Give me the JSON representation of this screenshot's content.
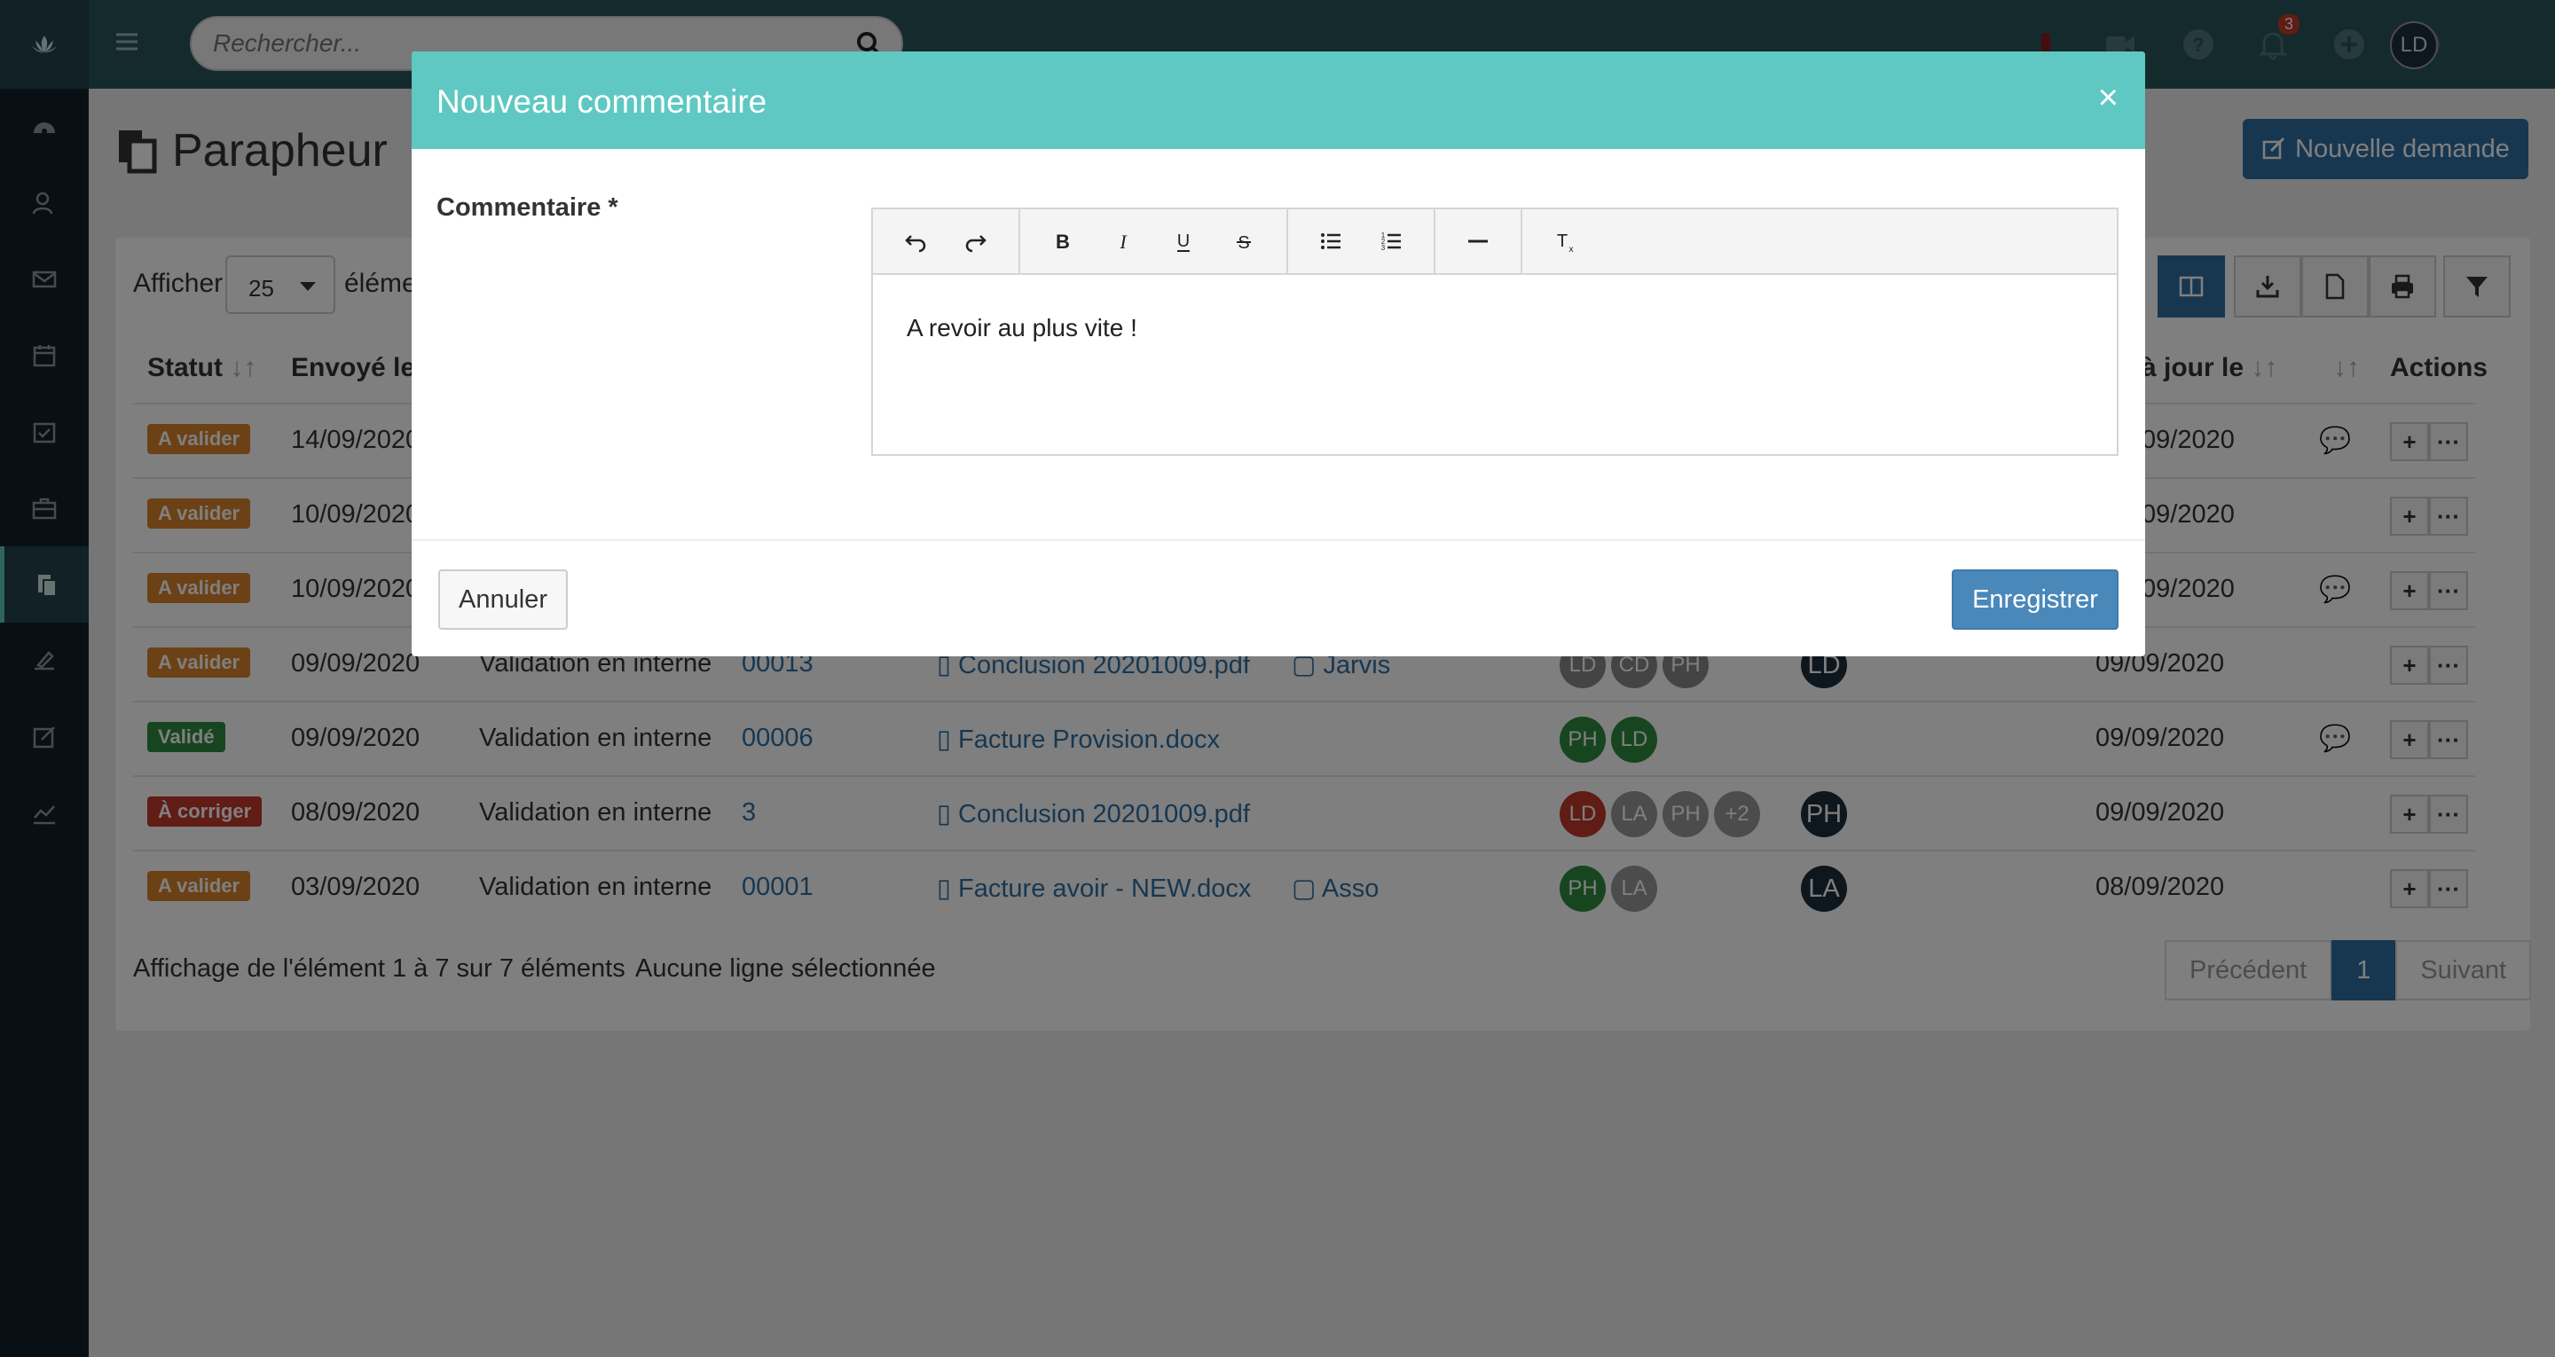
{
  "colors": {
    "accent": "#5fc8c2",
    "primary": "#2f6fa3",
    "sidebar": "#13212b",
    "topbar": "#2a5458",
    "warning": "#d9822b",
    "success": "#2e8b3e",
    "danger": "#c0392b"
  },
  "topbar": {
    "search_placeholder": "Rechercher...",
    "notifications_count": "3",
    "avatar": "LD"
  },
  "sidebar": {
    "items": [
      "dashboard-icon",
      "contacts-icon",
      "mail-icon",
      "calendar-icon",
      "tasks-icon",
      "briefcase-icon",
      "parapheur-icon",
      "signature-icon",
      "edit-icon",
      "chart-icon"
    ],
    "active": "parapheur-icon"
  },
  "page": {
    "title": "Parapheur",
    "new_request": "Nouvelle demande"
  },
  "table": {
    "show_label": "Afficher",
    "page_size": "25",
    "elements_label": "éléme",
    "headers": {
      "status": "Statut",
      "sent": "Envoyé le",
      "updated": "à jour le",
      "actions": "Actions"
    },
    "rows": [
      {
        "status": "A valider",
        "status_color": "#d9822b",
        "sent": "14/09/2020",
        "updated": "09/2020",
        "comment": true
      },
      {
        "status": "A valider",
        "status_color": "#d9822b",
        "sent": "10/09/2020",
        "updated": "09/2020",
        "comment": false
      },
      {
        "status": "A valider",
        "status_color": "#d9822b",
        "sent": "10/09/2020",
        "updated": "09/2020",
        "comment": true
      },
      {
        "status": "A valider",
        "status_color": "#d9822b",
        "sent": "09/09/2020",
        "type": "Validation en interne",
        "ref": "00013",
        "file": "Conclusion 20201009.pdf",
        "file_icon": "pdf-icon",
        "folder": "Jarvis",
        "folder_icon": "folder-icon",
        "signers": [
          {
            "t": "LD",
            "c": "#888"
          },
          {
            "t": "CD",
            "c": "#888"
          },
          {
            "t": "PH",
            "c": "#888"
          }
        ],
        "owner": "LD",
        "updated": "09/09/2020",
        "comment": false
      },
      {
        "status": "Validé",
        "status_color": "#2e8b3e",
        "sent": "09/09/2020",
        "type": "Validation en interne",
        "ref": "00006",
        "file": "Facture Provision.docx",
        "file_icon": "word-icon",
        "folder": "",
        "signers": [
          {
            "t": "PH",
            "c": "#2e8b3e"
          },
          {
            "t": "LD",
            "c": "#2e8b3e"
          }
        ],
        "owner": "",
        "updated": "09/09/2020",
        "comment": true
      },
      {
        "status": "À corriger",
        "status_color": "#c0392b",
        "sent": "08/09/2020",
        "type": "Validation en interne",
        "ref": "3",
        "file": "Conclusion 20201009.pdf",
        "file_icon": "pdf-icon",
        "folder": "",
        "signers": [
          {
            "t": "LD",
            "c": "#c0392b"
          },
          {
            "t": "LA",
            "c": "#999"
          },
          {
            "t": "PH",
            "c": "#999"
          },
          {
            "t": "+2",
            "c": "#999"
          }
        ],
        "owner": "PH",
        "updated": "09/09/2020",
        "comment": false
      },
      {
        "status": "A valider",
        "status_color": "#d9822b",
        "sent": "03/09/2020",
        "type": "Validation en interne",
        "ref": "00001",
        "file": "Facture avoir - NEW.docx",
        "file_icon": "word-icon",
        "folder": "Asso",
        "folder_icon": "briefcase-icon",
        "signers": [
          {
            "t": "PH",
            "c": "#2e8b3e"
          },
          {
            "t": "LA",
            "c": "#999"
          }
        ],
        "owner": "LA",
        "updated": "08/09/2020",
        "comment": false
      }
    ]
  },
  "footer": {
    "info": "Affichage de l'élément 1 à 7 sur 7 éléments",
    "selection": "Aucune ligne sélectionnée",
    "prev": "Précédent",
    "page": "1",
    "next": "Suivant"
  },
  "modal": {
    "title": "Nouveau commentaire",
    "close": "×",
    "field_label": "Commentaire *",
    "content": "A revoir au plus vite !",
    "toolbar": [
      "undo-icon",
      "redo-icon",
      "bold-icon",
      "italic-icon",
      "underline-icon",
      "strikethrough-icon",
      "bullet-list-icon",
      "numbered-list-icon",
      "horizontal-rule-icon",
      "clear-format-icon"
    ],
    "cancel": "Annuler",
    "save": "Enregistrer"
  }
}
